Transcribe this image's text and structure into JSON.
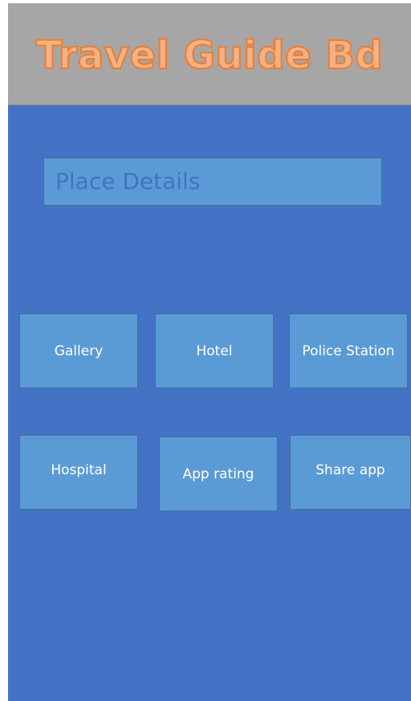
{
  "header": {
    "title": "Travel Guide Bd"
  },
  "place_details": {
    "placeholder": "Place Details"
  },
  "tiles": {
    "gallery": "Gallery",
    "hotel": "Hotel",
    "police_station": "Police Station",
    "hospital": "Hospital",
    "app_rating": "App rating",
    "share_app": "Share app"
  },
  "colors": {
    "background": "#4472c4",
    "header": "#a6a6a6",
    "title_fill": "#f4b183",
    "title_outline": "#ed7d31",
    "tile": "#5b9bd5",
    "tile_border": "#41719c",
    "tile_text": "#ffffff"
  }
}
